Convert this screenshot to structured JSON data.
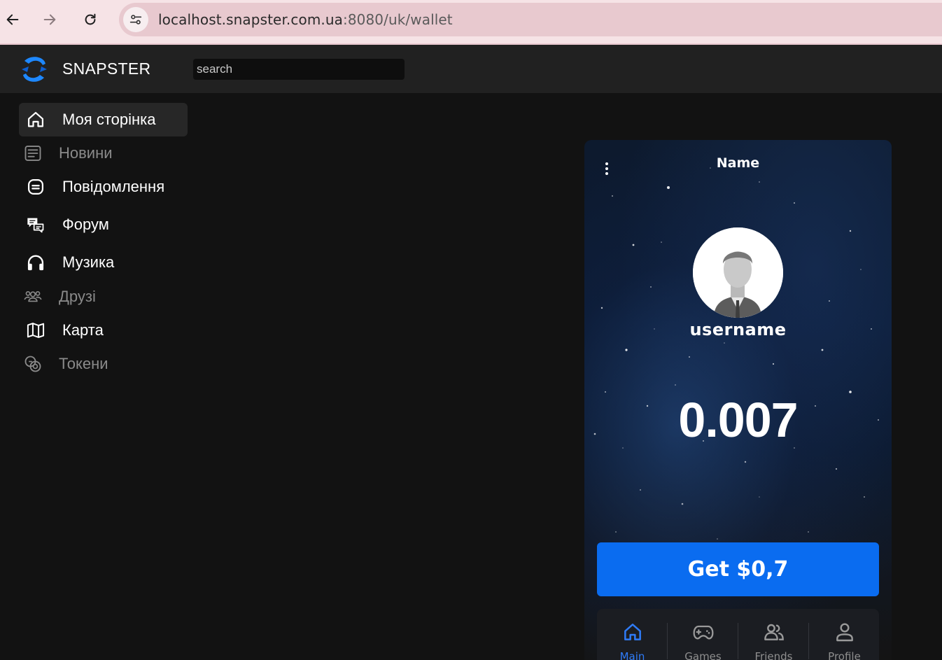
{
  "browser": {
    "url_host": "localhost.snapster.com.ua",
    "url_path": ":8080/uk/wallet"
  },
  "header": {
    "brand": "SNAPSTER",
    "search_placeholder": "search"
  },
  "sidebar": {
    "items": [
      {
        "label": "Моя сторінка",
        "icon": "home-icon",
        "state": "active"
      },
      {
        "label": "Новини",
        "icon": "newspaper-icon",
        "state": "dim"
      },
      {
        "label": "Повідомлення",
        "icon": "message-icon",
        "state": "normal"
      },
      {
        "label": "Форум",
        "icon": "forum-icon",
        "state": "normal"
      },
      {
        "label": "Музика",
        "icon": "headphones-icon",
        "state": "normal"
      },
      {
        "label": "Друзі",
        "icon": "friends-icon",
        "state": "dim"
      },
      {
        "label": "Карта",
        "icon": "map-icon",
        "state": "normal"
      },
      {
        "label": "Токени",
        "icon": "tokens-icon",
        "state": "dim"
      }
    ]
  },
  "wallet": {
    "title": "Name",
    "username": "username",
    "balance": "0.007",
    "get_button": "Get $0,7"
  },
  "tabbar": {
    "tabs": [
      {
        "label": "Main",
        "icon": "home-icon",
        "active": true
      },
      {
        "label": "Games",
        "icon": "gamepad-icon",
        "active": false
      },
      {
        "label": "Friends",
        "icon": "friends-icon",
        "active": false
      },
      {
        "label": "Profile",
        "icon": "user-icon",
        "active": false
      }
    ]
  },
  "colors": {
    "accent": "#0a6cf0",
    "active_tab": "#2f7bf6",
    "background": "#121212",
    "header": "#212121"
  }
}
